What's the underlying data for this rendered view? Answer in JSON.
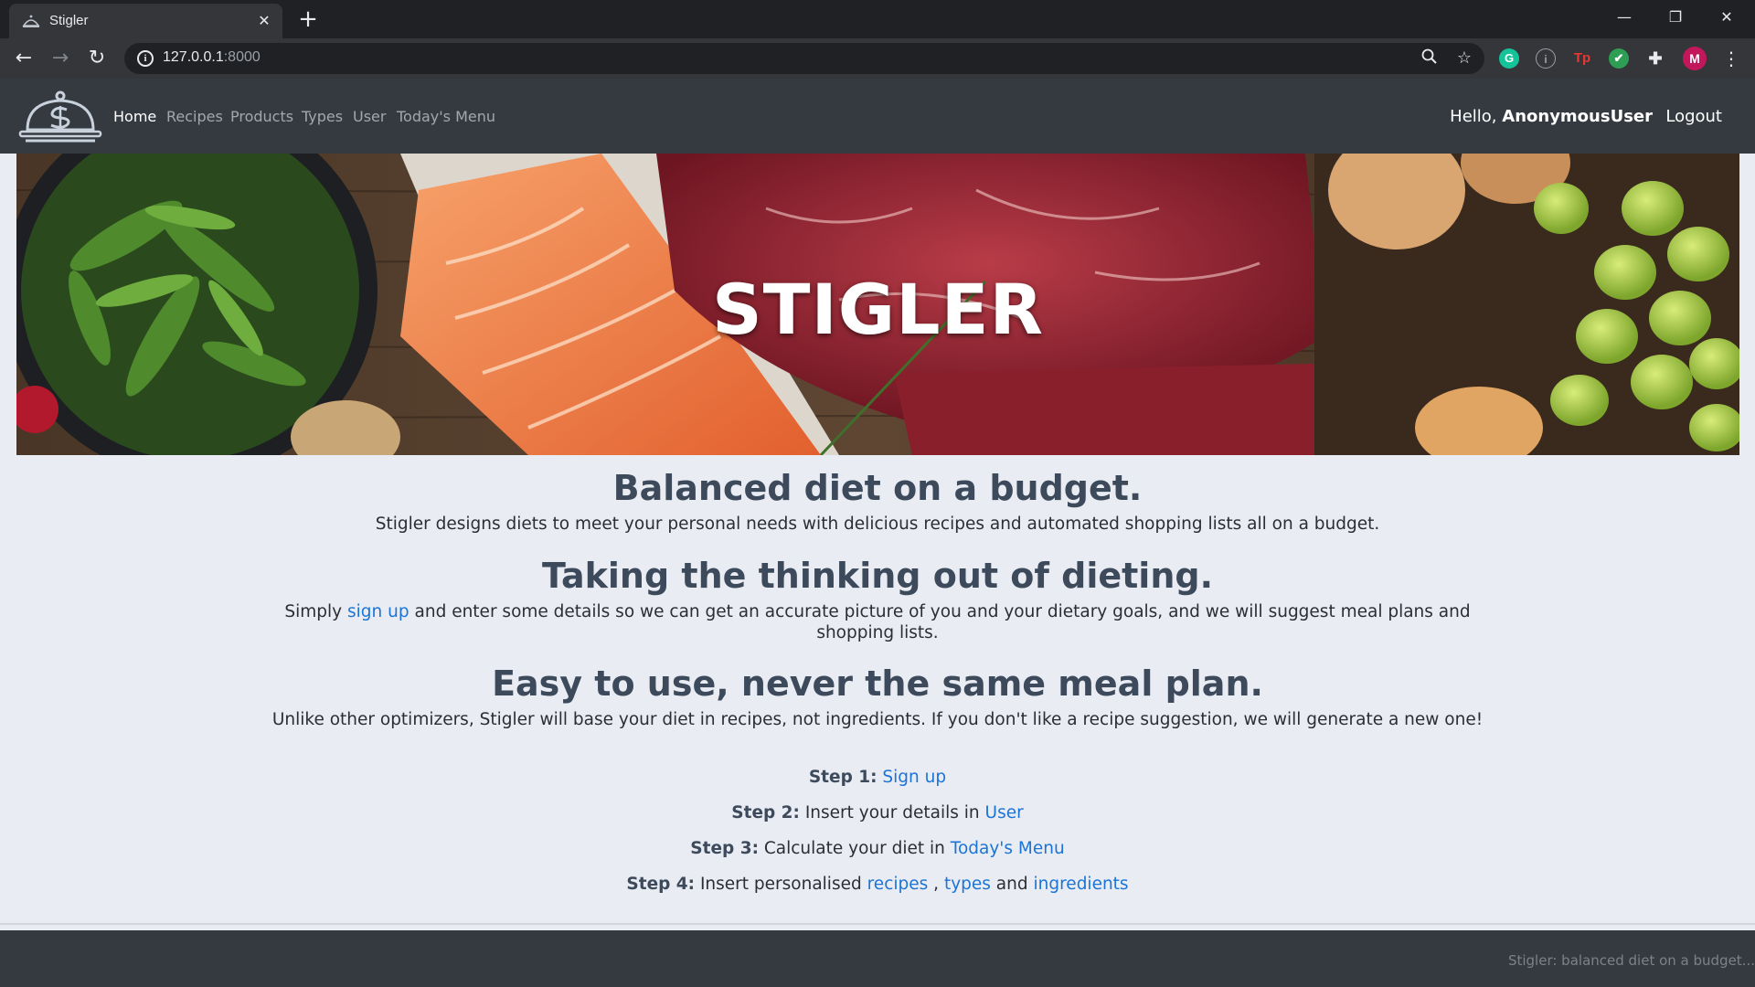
{
  "browser": {
    "tab_title": "Stigler",
    "tab_close": "✕",
    "new_tab": "+",
    "url_host": "127.0.0.1",
    "url_port": ":8000",
    "back": "←",
    "forward": "→",
    "reload": "↻",
    "extensions": [
      {
        "name": "grammarly-icon",
        "glyph": "G",
        "bg": "#15c39a",
        "fg": "#ffffff"
      },
      {
        "name": "info-extension-icon",
        "glyph": "i",
        "bg": "transparent",
        "fg": "#9aa0a6"
      },
      {
        "name": "tp-extension-icon",
        "glyph": "Tp",
        "bg": "transparent",
        "fg": "#e53935"
      },
      {
        "name": "shield-extension-icon",
        "glyph": "✔",
        "bg": "#2e9e55",
        "fg": "#ffffff"
      }
    ],
    "profile_initial": "M",
    "colors": {
      "profile": "#c2185b"
    }
  },
  "nav": {
    "items": [
      {
        "label": "Home",
        "active": true
      },
      {
        "label": "Recipes",
        "active": false
      },
      {
        "label": "Products",
        "active": false
      },
      {
        "label": "Types",
        "active": false
      },
      {
        "label": "User",
        "active": false
      },
      {
        "label": "Today's Menu",
        "active": false
      }
    ],
    "hello_prefix": "Hello,",
    "username": "AnonymousUser",
    "logout": "Logout"
  },
  "hero": {
    "title": "STIGLER"
  },
  "sections": [
    {
      "heading": "Balanced diet on a budget.",
      "text": "Stigler designs diets to meet your personal needs with delicious recipes and automated shopping lists all on a budget."
    },
    {
      "heading": "Taking the thinking out of dieting.",
      "text_before": "Simply",
      "link": "sign up",
      "text_after": "and enter some details so we can get an accurate picture of you and your dietary goals, and we will suggest meal plans and shopping lists."
    },
    {
      "heading": "Easy to use, never the same meal plan.",
      "text": "Unlike other optimizers, Stigler will base your diet in recipes, not ingredients. If you don't like a recipe suggestion, we will generate a new one!"
    }
  ],
  "steps": {
    "s1_label": "Step 1:",
    "s1_link": "Sign up",
    "s2_label": "Step 2:",
    "s2_text": "Insert your details in",
    "s2_link": "User",
    "s3_label": "Step 3:",
    "s3_text": "Calculate your diet in",
    "s3_link": "Today's Menu",
    "s4_label": "Step 4:",
    "s4_text": "Insert personalised",
    "s4_link1": "recipes",
    "s4_sep": ",",
    "s4_link2": "types",
    "s4_and": "and",
    "s4_link3": "ingredients"
  },
  "footer": {
    "text": "Stigler: balanced diet on a budget..."
  }
}
